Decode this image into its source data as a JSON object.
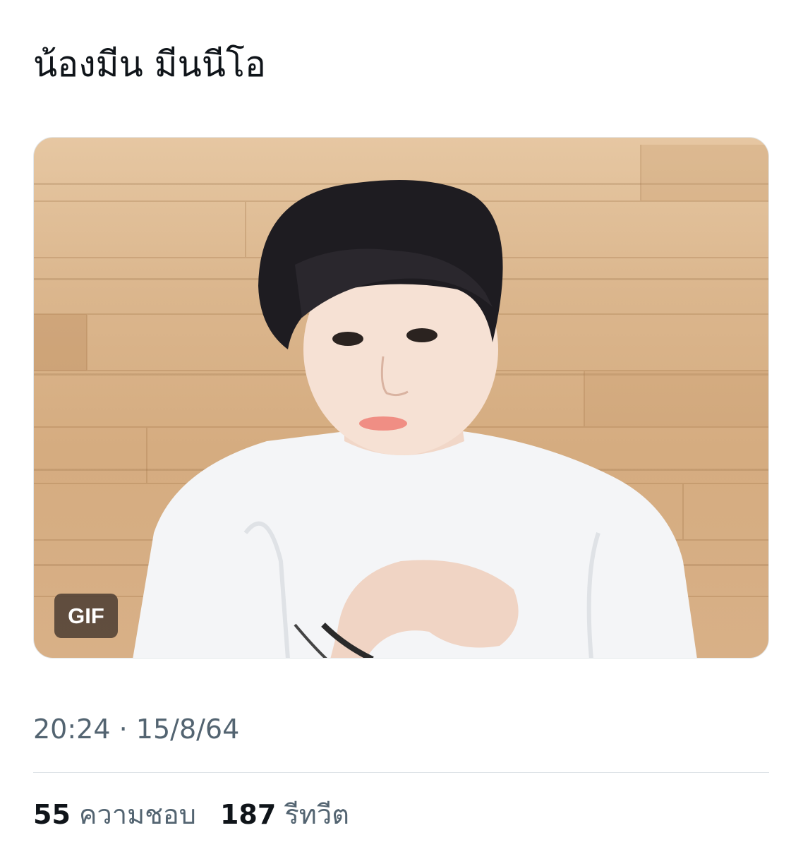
{
  "tweet": {
    "text": "น้องมีน มีนนีโอ",
    "media": {
      "badge": "GIF"
    },
    "time": "20:24",
    "separator": "·",
    "date": "15/8/64",
    "likes": {
      "count": "55",
      "label": "ความชอบ"
    },
    "retweets": {
      "count": "187",
      "label": "รีทวีต"
    }
  },
  "colors": {
    "text_primary": "#0f1419",
    "text_secondary": "#536471",
    "divider": "#dde3e7",
    "badge_bg": "#504034"
  }
}
